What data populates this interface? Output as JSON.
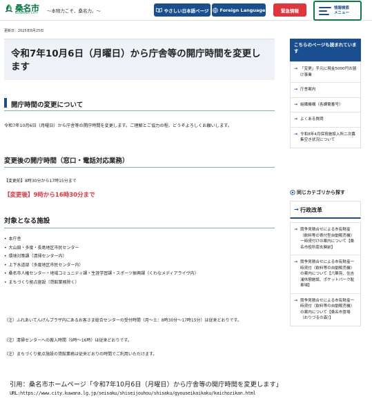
{
  "header": {
    "logo_name": "桑名市",
    "logo_sub": "KUWANA CITY",
    "tagline": "～本物力こそ、桑名力。～",
    "easy_japanese": "やさしい日本語ページ",
    "foreign_language": "Foreign Language",
    "urgent": "緊急情報",
    "menu_line1": "情報検索",
    "menu_line2": "メニュー",
    "colors": {
      "green": "#0a7a45",
      "navy": "#1a4f8f",
      "red": "#e0353d"
    }
  },
  "main": {
    "updated": "更新日：2025年8月25日",
    "title": "令和7年10月6日（月曜日）から庁舎等の開庁時間を変更します",
    "section_heading": "開庁時間の変更について",
    "intro": "令和7年10月6日（月曜日）から庁舎等の開庁時間を変更します。ご理解とご協力の程、どうぞよろしくお願いします。",
    "hours_heading": "変更後の開庁時間（窓口・電話対応業務）",
    "before": "【変更前】8時30分から17時15分まで",
    "after": "【変更後】9時から16時30分まで",
    "facilities_heading": "対象となる施設",
    "facilities": [
      "本庁舎",
      "大山田・多度・長島地区市民センター",
      "環境対策課（清掃センター内）",
      "上下水道部（多度地区市民センター内）",
      "桑名市人権センター・地域コミュニティ課・生涯学習課・スポーツ振興課（くわなメディアライヴ内）",
      "まちづくり拠点施設（貸館業務除く）"
    ],
    "notes": [
      "（注）ふれあいてんげんプラザ内にあるお客さま総合センターの受付時間（月～土：8時30分～17時15分）は従来どおりです。",
      "（注）清掃センターへの搬入時間（9時～16時）は従来どおりです。",
      "（注）まちづくり拠点施設の貸館業務は従来どおりの時間でご利用いただけます。"
    ]
  },
  "sidebar": {
    "also_read_heading": "こちらのページも読まれています",
    "also_read": [
      "「変更」手元に現金5000円お届け事業",
      "庁舎案内",
      "組織機構（各課電番号）",
      "よくある質問",
      "令和8年4月保育施設入所二次募集空き状況について"
    ],
    "same_category_heading": "同じカテゴリから探す",
    "category_name": "行政改革",
    "category_items": [
      "競争見積合せによる市有財産（飲料等の寄付型自動販売機）一時貸付けの案内について【桑名市役所南玄関前】",
      "競争見積合せによる市有財産一時貸付（飲料等の自動販売機）の案内について【六華苑、住吉浦休憩施設、ポケットパーク駐車場】",
      "競争見積合せによる市有財産一時貸付（飲料等の自動販売機）の案内について【桑名市営場（おりづるの森）】"
    ]
  },
  "footer": {
    "citation": "引用：桑名市ホームページ「令和7年10月6日（月曜日）から庁舎等の開庁時間を変更します」",
    "url": "URL:https://www.city.kuwana.lg.jp/seisaku/shiseijouhou/shisaku/gyouseikaikaku/kaichozikan.html"
  }
}
